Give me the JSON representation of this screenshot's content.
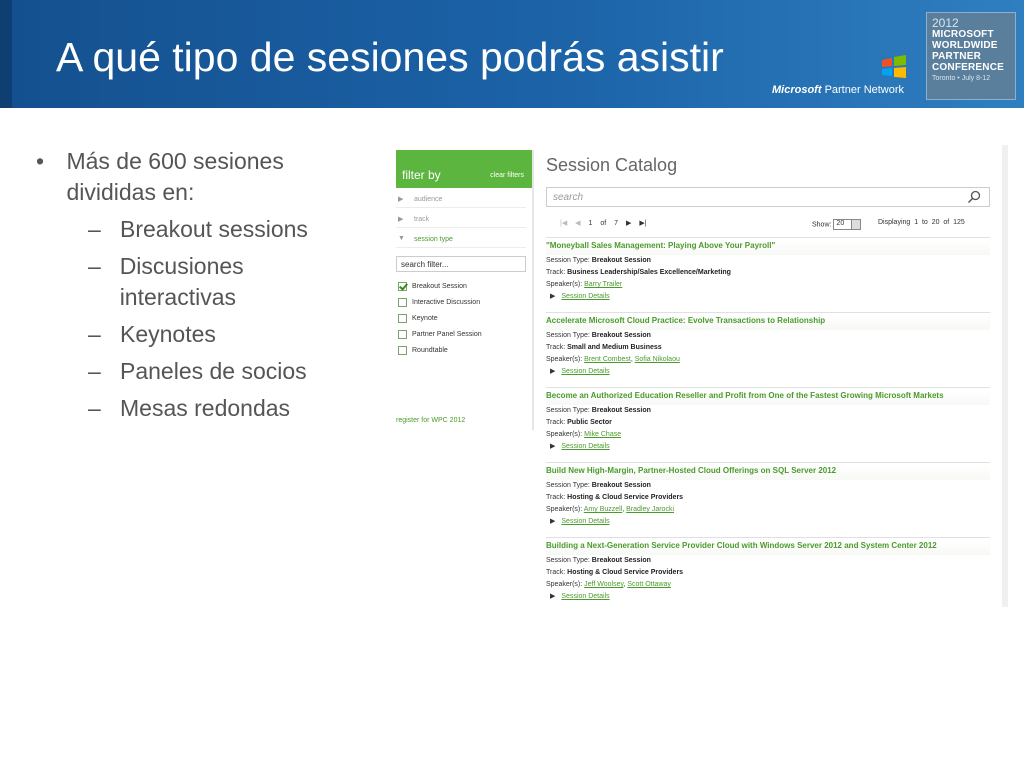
{
  "slide": {
    "title": "A qué tipo de sesiones podrás asistir",
    "partner_network": "Partner Network",
    "microsoft": "Microsoft",
    "badge": {
      "year": "2012",
      "lines": [
        "MICROSOFT",
        "WORLDWIDE",
        "PARTNER",
        "CONFERENCE"
      ],
      "date": "Toronto • July 8-12"
    }
  },
  "bullets": {
    "main": "Más de 600 sesiones divididas en:",
    "items": [
      "Breakout sessions",
      "Discusiones interactivas",
      "Keynotes",
      "Paneles de socios",
      "Mesas redondas"
    ]
  },
  "filter": {
    "title": "filter by",
    "clear": "clear filters",
    "facets": [
      "audience",
      "track",
      "session type"
    ],
    "search_placeholder": "search filter...",
    "options": [
      {
        "label": "Breakout Session",
        "checked": true
      },
      {
        "label": "Interactive Discussion",
        "checked": false
      },
      {
        "label": "Keynote",
        "checked": false
      },
      {
        "label": "Partner Panel Session",
        "checked": false
      },
      {
        "label": "Roundtable",
        "checked": false
      }
    ],
    "register": "register for WPC 2012"
  },
  "catalog": {
    "title": "Session Catalog",
    "search_placeholder": "search",
    "pager": {
      "page": "1",
      "of": "of",
      "total_pages": "7",
      "show_label": "Show:",
      "show_value": "20",
      "displaying": "Displaying",
      "from": "1",
      "to": "to",
      "to_value": "20",
      "of2": "of",
      "total": "125"
    },
    "labels": {
      "type": "Session Type:",
      "track": "Track:",
      "speakers": "Speaker(s):",
      "details": "Session Details"
    },
    "sessions": [
      {
        "title": "\"Moneyball Sales Management: Playing Above Your Payroll\"",
        "type": "Breakout Session",
        "track": "Business Leadership/Sales Excellence/Marketing",
        "speakers": [
          "Barry Trailer"
        ]
      },
      {
        "title": "Accelerate Microsoft Cloud Practice: Evolve Transactions to Relationship",
        "type": "Breakout Session",
        "track": "Small and Medium Business",
        "speakers": [
          "Brent Combest",
          "Sofia Nikolaou"
        ]
      },
      {
        "title": "Become an Authorized Education Reseller and Profit from One of the Fastest Growing Microsoft Markets",
        "type": "Breakout Session",
        "track": "Public Sector",
        "speakers": [
          "Mike Chase"
        ]
      },
      {
        "title": "Build New High-Margin, Partner-Hosted Cloud Offerings on SQL Server 2012",
        "type": "Breakout Session",
        "track": "Hosting & Cloud Service Providers",
        "speakers": [
          "Amy Buzzell",
          "Bradley Jarocki"
        ]
      },
      {
        "title": "Building a Next-Generation Service Provider Cloud with Windows Server 2012 and System Center 2012",
        "type": "Breakout Session",
        "track": "Hosting & Cloud Service Providers",
        "speakers": [
          "Jeff Woolsey",
          "Scott Ottaway"
        ]
      }
    ]
  }
}
